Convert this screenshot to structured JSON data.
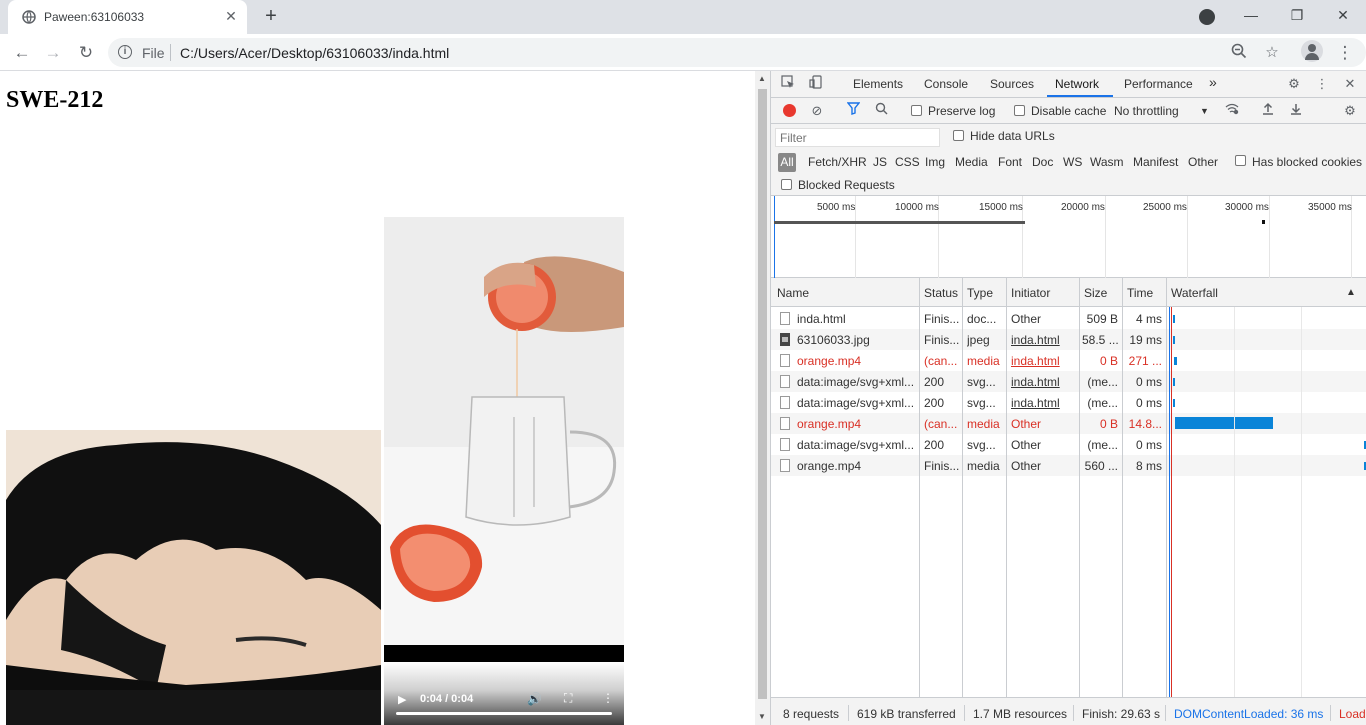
{
  "browser": {
    "tab_title": "Paween:63106033",
    "tab_close": "✕",
    "new_tab": "+",
    "url_scheme": "File",
    "url": "C:/Users/Acer/Desktop/63106033/inda.html",
    "window_controls": [
      "—",
      "❐",
      "✕"
    ]
  },
  "page": {
    "heading": "SWE-212",
    "video": {
      "current_time": "0:04 / 0:04",
      "progress": 1.0
    }
  },
  "devtools": {
    "tabs": [
      "Elements",
      "Console",
      "Sources",
      "Network",
      "Performance"
    ],
    "active_tab": "Network",
    "more_tabs": "»",
    "toolbar": {
      "preserve_log": "Preserve log",
      "disable_cache": "Disable cache",
      "throttling": "No throttling"
    },
    "filter": {
      "placeholder": "Filter",
      "hide_data_urls": "Hide data URLs",
      "types": [
        "All",
        "Fetch/XHR",
        "JS",
        "CSS",
        "Img",
        "Media",
        "Font",
        "Doc",
        "WS",
        "Wasm",
        "Manifest",
        "Other"
      ],
      "has_blocked_cookies": "Has blocked cookies",
      "blocked_requests": "Blocked Requests"
    },
    "overview_ticks": [
      "5000 ms",
      "10000 ms",
      "15000 ms",
      "20000 ms",
      "25000 ms",
      "30000 ms",
      "35000 ms"
    ],
    "columns": [
      "Name",
      "Status",
      "Type",
      "Initiator",
      "Size",
      "Time",
      "Waterfall"
    ],
    "sort_indicator": "▲",
    "rows": [
      {
        "name": "inda.html",
        "status": "Finis...",
        "type": "doc...",
        "initiator": "Other",
        "initiator_link": false,
        "size": "509 B",
        "time": "4 ms",
        "error": false,
        "icon": "doc"
      },
      {
        "name": "63106033.jpg",
        "status": "Finis...",
        "type": "jpeg",
        "initiator": "inda.html",
        "initiator_link": true,
        "size": "58.5 ...",
        "time": "19 ms",
        "error": false,
        "icon": "img"
      },
      {
        "name": "orange.mp4",
        "status": "(can...",
        "type": "media",
        "initiator": "inda.html",
        "initiator_link": true,
        "size": "0 B",
        "time": "271 ...",
        "error": true,
        "icon": "doc"
      },
      {
        "name": "data:image/svg+xml...",
        "status": "200",
        "type": "svg...",
        "initiator": "inda.html",
        "initiator_link": true,
        "size": "(me...",
        "time": "0 ms",
        "error": false,
        "icon": "doc"
      },
      {
        "name": "data:image/svg+xml...",
        "status": "200",
        "type": "svg...",
        "initiator": "inda.html",
        "initiator_link": true,
        "size": "(me...",
        "time": "0 ms",
        "error": false,
        "icon": "doc"
      },
      {
        "name": "orange.mp4",
        "status": "(can...",
        "type": "media",
        "initiator": "Other",
        "initiator_link": false,
        "size": "0 B",
        "time": "14.8...",
        "error": true,
        "icon": "doc"
      },
      {
        "name": "data:image/svg+xml...",
        "status": "200",
        "type": "svg...",
        "initiator": "Other",
        "initiator_link": false,
        "size": "(me...",
        "time": "0 ms",
        "error": false,
        "icon": "doc"
      },
      {
        "name": "orange.mp4",
        "status": "Finis...",
        "type": "media",
        "initiator": "Other",
        "initiator_link": false,
        "size": "560 ...",
        "time": "8 ms",
        "error": false,
        "icon": "doc"
      }
    ],
    "status": {
      "requests": "8 requests",
      "transferred": "619 kB transferred",
      "resources": "1.7 MB resources",
      "finish": "Finish: 29.63 s",
      "dom_content_loaded": "DOMContentLoaded: 36 ms",
      "load": "Load"
    },
    "colors": {
      "accent": "#1a73e8",
      "error": "#d93025",
      "record": "#e8382e",
      "waterfall": "#0a84d8"
    }
  }
}
